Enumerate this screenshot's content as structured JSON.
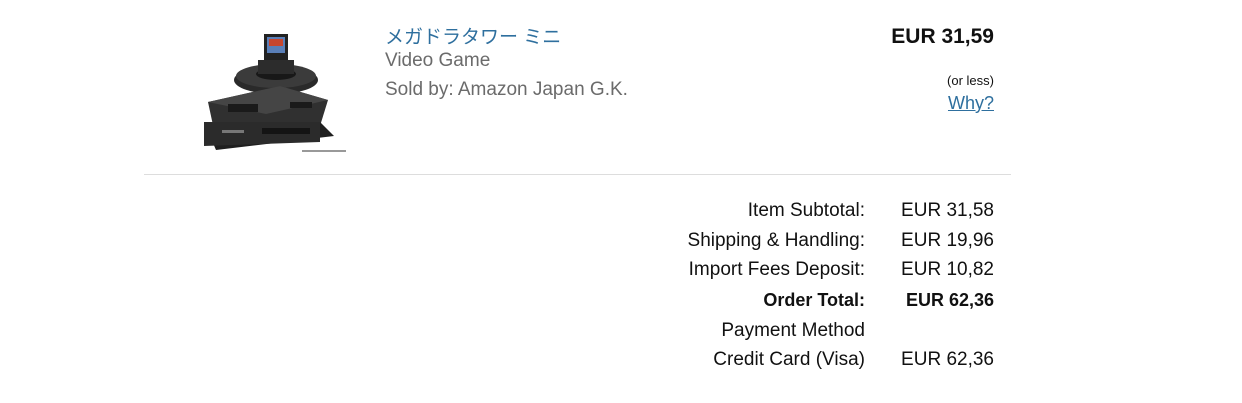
{
  "product": {
    "title": "メガドラタワー ミニ",
    "category": "Video Game",
    "seller": "Sold by: Amazon Japan G.K.",
    "price": "EUR 31,59",
    "price_note": "(or less)",
    "why_link": "Why?"
  },
  "summary": {
    "rows": [
      {
        "label": "Item Subtotal:",
        "value": "EUR 31,58"
      },
      {
        "label": "Shipping & Handling:",
        "value": "EUR 19,96"
      },
      {
        "label": "Import Fees Deposit:",
        "value": "EUR 10,82"
      },
      {
        "label": "Order Total:",
        "value": "EUR 62,36"
      },
      {
        "label": "Payment Method",
        "value": ""
      },
      {
        "label": "Credit Card (Visa)",
        "value": "EUR 62,36"
      }
    ]
  },
  "colors": {
    "link": "#2e6f9e",
    "muted_text": "#6b6b6b",
    "divider": "#dddddd"
  }
}
